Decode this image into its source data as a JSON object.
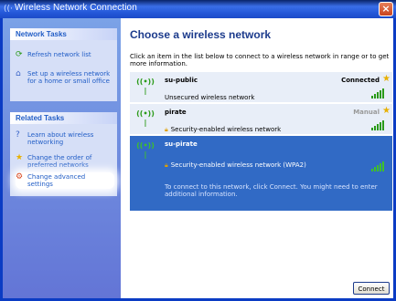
{
  "window": {
    "title": "Wireless Network Connection"
  },
  "sidebar": {
    "network_tasks": {
      "title": "Network Tasks",
      "items": [
        {
          "label": "Refresh network list",
          "icon": "refresh-icon"
        },
        {
          "label": "Set up a wireless network for a home or small office",
          "icon": "setup-wireless-icon"
        }
      ]
    },
    "related_tasks": {
      "title": "Related Tasks",
      "items": [
        {
          "label": "Learn about wireless networking",
          "icon": "help-icon"
        },
        {
          "label": "Change the order of preferred networks",
          "icon": "star-icon"
        },
        {
          "label": "Change advanced settings",
          "icon": "settings-icon"
        }
      ]
    }
  },
  "main": {
    "heading": "Choose a wireless network",
    "instruction": "Click an item in the list below to connect to a wireless network in range or to get more information.",
    "networks": [
      {
        "name": "su-public",
        "status": "Connected",
        "security": "Unsecured wireless network",
        "signal": "5 of 5 bars"
      },
      {
        "name": "pirate",
        "status": "Manual",
        "security": "Security-enabled wireless network",
        "signal": "5 of 5 bars"
      },
      {
        "name": "su-pirate",
        "status": "",
        "security": "Security-enabled wireless network (WPA2)",
        "signal": "5 of 5 bars",
        "note": "To connect to this network, click Connect. You might need to enter additional information."
      }
    ],
    "connect_label": "Connect"
  },
  "colors": {
    "title_bar": "#2458d8",
    "sidebar": "#7ba2e7",
    "selected_row": "#316ac5",
    "link": "#215dc6"
  }
}
